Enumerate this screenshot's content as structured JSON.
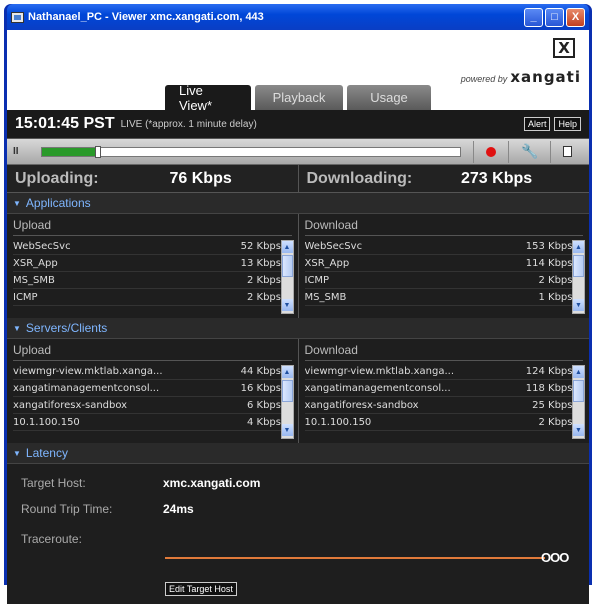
{
  "window": {
    "title": "Nathanael_PC - Viewer xmc.xangati.com, 443",
    "minimize": "_",
    "maximize": "□",
    "close": "X"
  },
  "brand": {
    "logo_glyph": "X",
    "powered_by": "powered by",
    "name": "xangati"
  },
  "tabs": [
    "Live View*",
    "Playback",
    "Usage"
  ],
  "status": {
    "time": "15:01:45 PST",
    "live_note": "LIVE (*approx. 1 minute  delay)",
    "alert_label": "Alert",
    "help_label": "Help"
  },
  "controls": {
    "pause_glyph": "II",
    "progress": 0.13,
    "wrench_glyph": "🔧"
  },
  "summary": {
    "upload_label": "Uploading:",
    "upload_value": "76 Kbps",
    "download_label": "Downloading:",
    "download_value": "273 Kbps"
  },
  "applications": {
    "title": "Applications",
    "upload_title": "Upload",
    "download_title": "Download",
    "upload_rows": [
      {
        "name": "WebSecSvc",
        "value": "52 Kbps"
      },
      {
        "name": "XSR_App",
        "value": "13 Kbps"
      },
      {
        "name": "MS_SMB",
        "value": "2 Kbps"
      },
      {
        "name": "ICMP",
        "value": "2 Kbps"
      }
    ],
    "download_rows": [
      {
        "name": "WebSecSvc",
        "value": "153 Kbps"
      },
      {
        "name": "XSR_App",
        "value": "114 Kbps"
      },
      {
        "name": "ICMP",
        "value": "2 Kbps"
      },
      {
        "name": "MS_SMB",
        "value": "1 Kbps"
      }
    ]
  },
  "servers": {
    "title": "Servers/Clients",
    "upload_title": "Upload",
    "download_title": "Download",
    "upload_rows": [
      {
        "name": "viewmgr-view.mktlab.xanga...",
        "value": "44 Kbps"
      },
      {
        "name": "xangatimanagementconsol...",
        "value": "16 Kbps"
      },
      {
        "name": "xangatiforesx-sandbox",
        "value": "6 Kbps"
      },
      {
        "name": "10.1.100.150",
        "value": "4 Kbps"
      }
    ],
    "download_rows": [
      {
        "name": "viewmgr-view.mktlab.xanga...",
        "value": "124 Kbps"
      },
      {
        "name": "xangatimanagementconsol...",
        "value": "118 Kbps"
      },
      {
        "name": "xangatiforesx-sandbox",
        "value": "25 Kbps"
      },
      {
        "name": "10.1.100.150",
        "value": "2 Kbps"
      }
    ]
  },
  "latency": {
    "title": "Latency",
    "target_label": "Target Host:",
    "target_value": "xmc.xangati.com",
    "rtt_label": "Round Trip Time:",
    "rtt_value": "24ms",
    "traceroute_label": "Traceroute:",
    "hops_glyph": "OOO",
    "edit_label": "Edit Target Host",
    "trace_color": "#e07a3a"
  }
}
